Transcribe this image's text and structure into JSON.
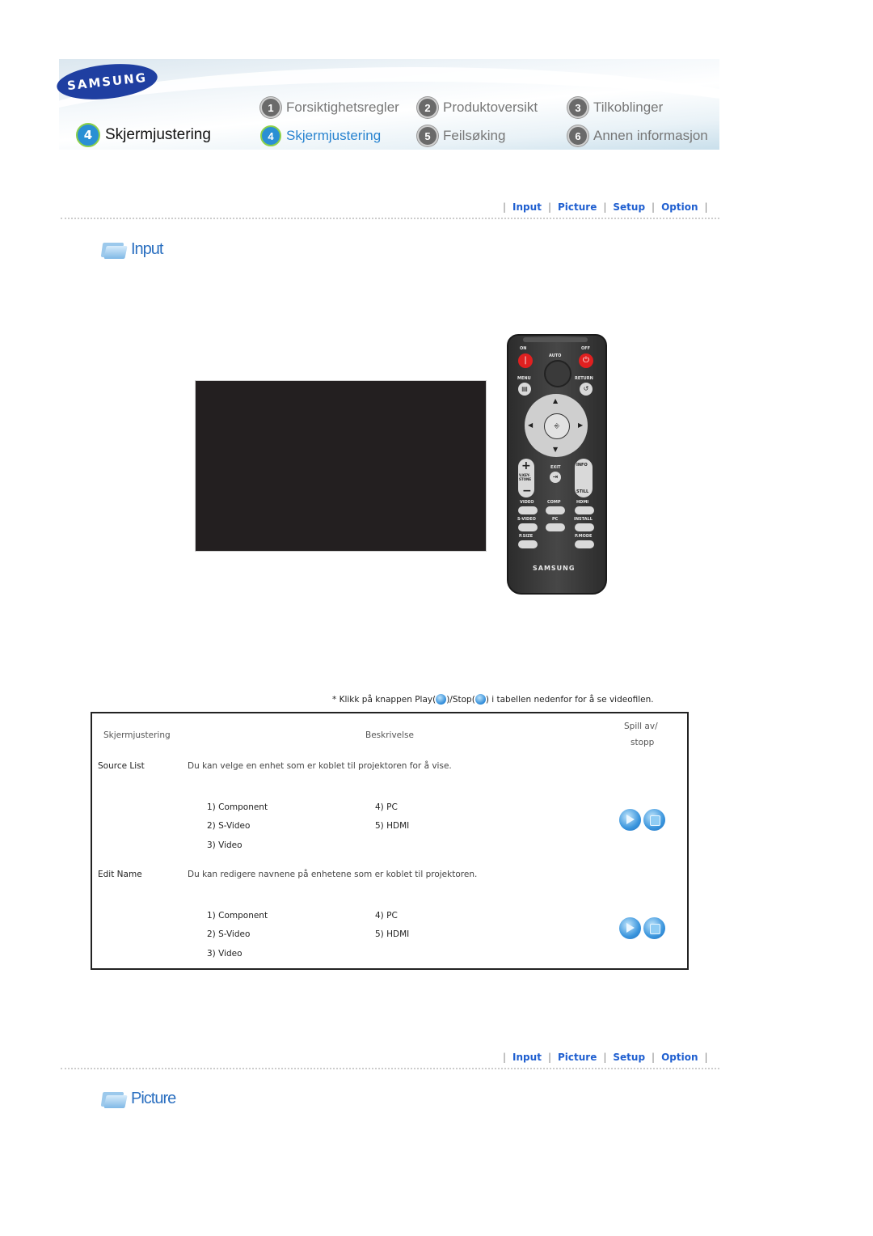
{
  "header": {
    "brand": "SAMSUNG",
    "current_section": {
      "number": "4",
      "label": "Skjermjustering"
    },
    "nav": [
      {
        "number": "1",
        "label": "Forsiktighetsregler",
        "active": false
      },
      {
        "number": "2",
        "label": "Produktoversikt",
        "active": false
      },
      {
        "number": "3",
        "label": "Tilkoblinger",
        "active": false
      },
      {
        "number": "4",
        "label": "Skjermjustering",
        "active": true
      },
      {
        "number": "5",
        "label": "Feilsøking",
        "active": false
      },
      {
        "number": "6",
        "label": "Annen informasjon",
        "active": false
      }
    ]
  },
  "section_nav": {
    "items": [
      "Input",
      "Picture",
      "Setup",
      "Option"
    ]
  },
  "sections": {
    "input": {
      "title": "Input"
    },
    "picture": {
      "title": "Picture"
    }
  },
  "remote": {
    "labels": {
      "on": "ON",
      "off": "OFF",
      "auto": "AUTO",
      "menu": "MENU",
      "return": "RETURN",
      "exit": "EXIT",
      "info": "INFO",
      "still": "STILL",
      "vkeystone": "V.KEY-STONE",
      "video": "VIDEO",
      "comp": "COMP",
      "hdmi": "HDMI",
      "svideo": "S-VIDEO",
      "pc": "PC",
      "install": "INSTALL",
      "psize": "P.SIZE",
      "pmode": "P.MODE",
      "brand": "SAMSUNG"
    }
  },
  "hint": {
    "prefix": "* Klikk på knappen Play(",
    "middle": ")/Stop(",
    "suffix": ") i tabellen nedenfor for å se videofilen."
  },
  "table": {
    "headers": {
      "setting": "Skjermjustering",
      "description": "Beskrivelse",
      "play_line1": "Spill av/",
      "play_line2": "stopp"
    },
    "rows": [
      {
        "name": "Source List",
        "description": "Du kan velge en enhet som er koblet til projektoren for å vise.",
        "options_left": [
          "1) Component",
          "2) S-Video",
          "3) Video"
        ],
        "options_right": [
          "4) PC",
          "5) HDMI"
        ]
      },
      {
        "name": "Edit Name",
        "description": "Du kan redigere navnene på enhetene som er koblet til projektoren.",
        "options_left": [
          "1) Component",
          "2) S-Video",
          "3) Video"
        ],
        "options_right": [
          "4) PC",
          "5) HDMI"
        ]
      }
    ]
  }
}
